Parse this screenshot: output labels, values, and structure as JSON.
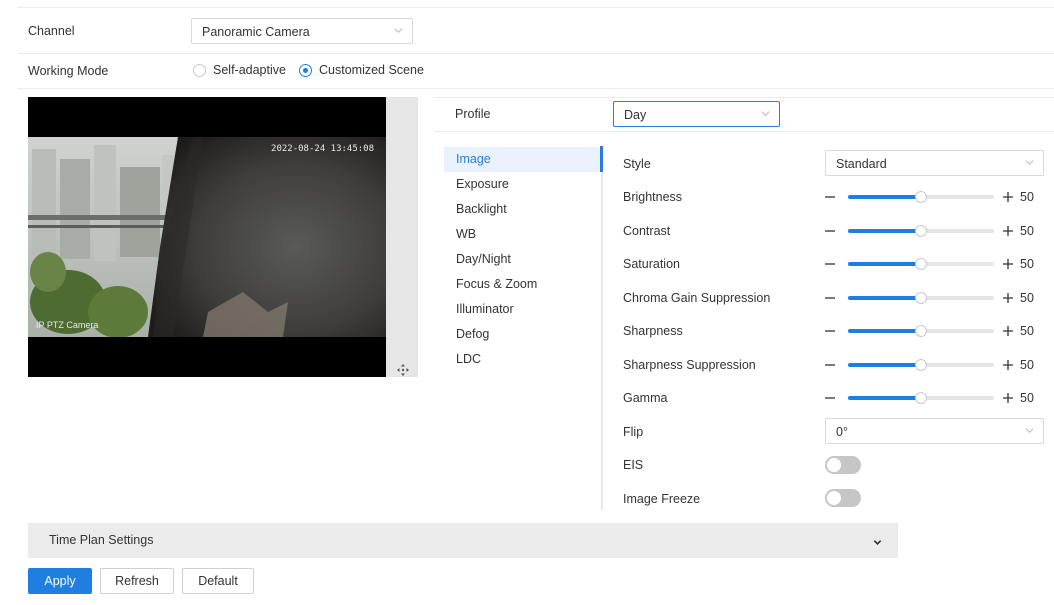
{
  "channel": {
    "label": "Channel",
    "value": "Panoramic Camera"
  },
  "working_mode": {
    "label": "Working Mode",
    "options": [
      {
        "label": "Self-adaptive",
        "selected": false
      },
      {
        "label": "Customized Scene",
        "selected": true
      }
    ]
  },
  "video": {
    "timestamp": "2022-08-24 13:45:08",
    "channel_name": "IP PTZ Camera"
  },
  "profile": {
    "label": "Profile",
    "value": "Day"
  },
  "menu": {
    "items": [
      "Image",
      "Exposure",
      "Backlight",
      "WB",
      "Day/Night",
      "Focus & Zoom",
      "Illuminator",
      "Defog",
      "LDC"
    ],
    "active": "Image"
  },
  "image_settings": {
    "style": {
      "label": "Style",
      "value": "Standard"
    },
    "sliders": [
      {
        "label": "Brightness",
        "value": 50,
        "max": 100
      },
      {
        "label": "Contrast",
        "value": 50,
        "max": 100
      },
      {
        "label": "Saturation",
        "value": 50,
        "max": 100
      },
      {
        "label": "Chroma Gain Suppression",
        "value": 50,
        "max": 100
      },
      {
        "label": "Sharpness",
        "value": 50,
        "max": 100
      },
      {
        "label": "Sharpness Suppression",
        "value": 50,
        "max": 100
      },
      {
        "label": "Gamma",
        "value": 50,
        "max": 100
      }
    ],
    "flip": {
      "label": "Flip",
      "value": "0°"
    },
    "eis": {
      "label": "EIS",
      "on": false
    },
    "image_freeze": {
      "label": "Image Freeze",
      "on": false
    }
  },
  "time_plan": {
    "label": "Time Plan Settings"
  },
  "buttons": {
    "apply": "Apply",
    "refresh": "Refresh",
    "default": "Default"
  },
  "colors": {
    "accent": "#1e7fe0",
    "active_bg": "#e8f1fc",
    "toggle_off": "#c6c6c6"
  }
}
